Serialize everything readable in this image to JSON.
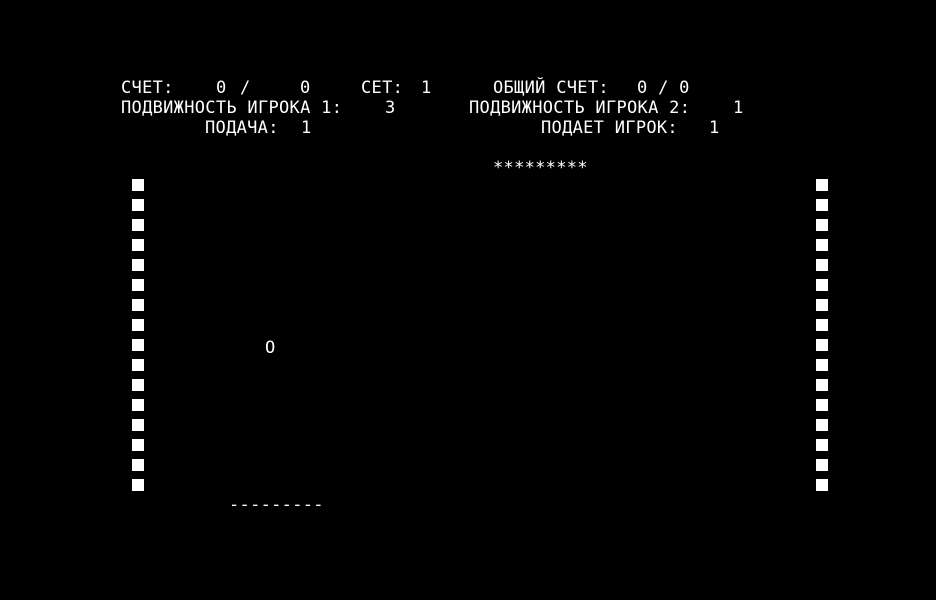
{
  "hud": {
    "score_label": "СЧЕТ:",
    "score_p1": "0",
    "score_sep": "/",
    "score_p2": "0",
    "set_label": "СЕТ:",
    "set_value": "1",
    "total_label": "ОБЩИЙ СЧЕТ:",
    "total_value": "0 / 0",
    "mobility_p1_label": "ПОДВИЖНОСТЬ ИГРОКА 1:",
    "mobility_p1_value": "3",
    "mobility_p2_label": "ПОДВИЖНОСТЬ ИГРОКА 2:",
    "mobility_p2_value": "1",
    "serve_label": "ПОДАЧА:",
    "serve_value": "1",
    "serving_label": "ПОДАЕТ ИГРОК:",
    "serving_value": "1"
  },
  "field": {
    "paddle_top": "*********",
    "paddle_bottom": "---------",
    "ball": "O",
    "wall_blocks": 16
  },
  "colors": {
    "background": "#000000",
    "foreground": "#ffffff"
  }
}
